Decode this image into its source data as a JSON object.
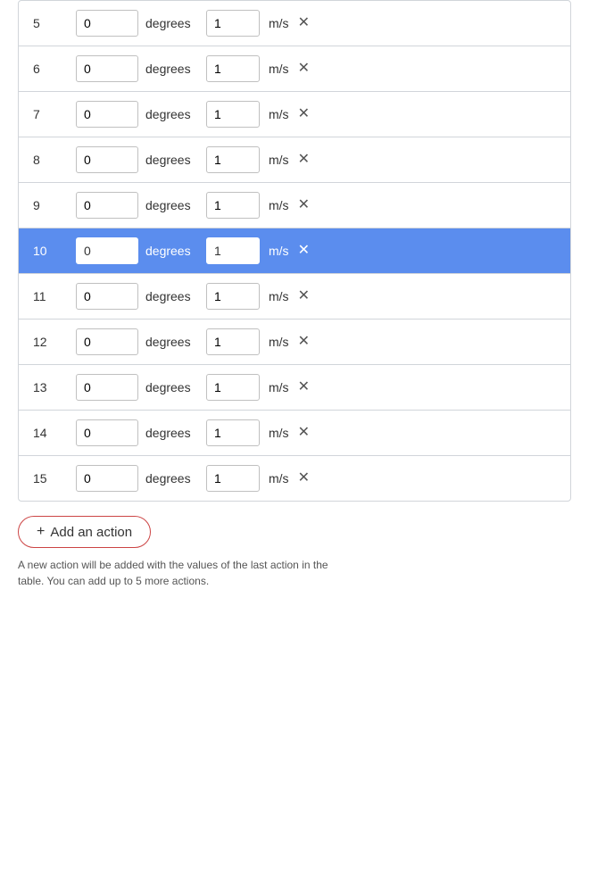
{
  "table": {
    "rows": [
      {
        "id": 5,
        "angle": "0",
        "speed": "1",
        "highlighted": false
      },
      {
        "id": 6,
        "angle": "0",
        "speed": "1",
        "highlighted": false
      },
      {
        "id": 7,
        "angle": "0",
        "speed": "1",
        "highlighted": false
      },
      {
        "id": 8,
        "angle": "0",
        "speed": "1",
        "highlighted": false
      },
      {
        "id": 9,
        "angle": "0",
        "speed": "1",
        "highlighted": false
      },
      {
        "id": 10,
        "angle": "0",
        "speed": "1",
        "highlighted": true
      },
      {
        "id": 11,
        "angle": "0",
        "speed": "1",
        "highlighted": false
      },
      {
        "id": 12,
        "angle": "0",
        "speed": "1",
        "highlighted": false
      },
      {
        "id": 13,
        "angle": "0",
        "speed": "1",
        "highlighted": false
      },
      {
        "id": 14,
        "angle": "0",
        "speed": "1",
        "highlighted": false
      },
      {
        "id": 15,
        "angle": "0",
        "speed": "1",
        "highlighted": false
      }
    ],
    "angle_unit": "degrees",
    "speed_unit": "m/s"
  },
  "add_action": {
    "button_label": "Add an action",
    "plus_symbol": "+",
    "hint": "A new action will be added with the values of the last action in the table. You can add up to 5 more actions."
  }
}
